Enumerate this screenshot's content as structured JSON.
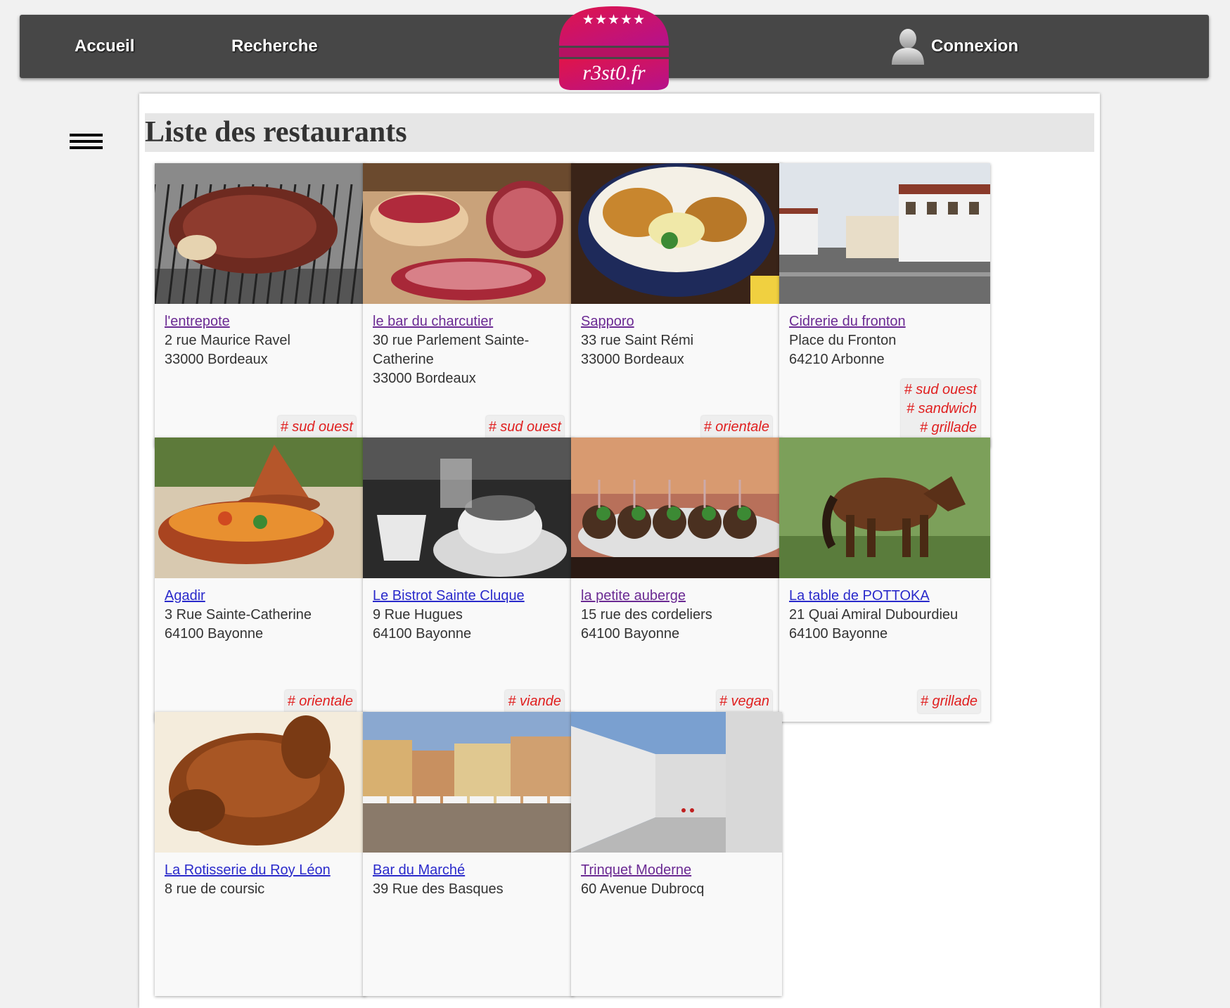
{
  "nav": {
    "accueil": "Accueil",
    "recherche": "Recherche",
    "connexion": "Connexion"
  },
  "logo": {
    "text": "r3st0.fr",
    "stars": "★★★★★",
    "color_top": "#e0144a",
    "color_bottom": "#b5128c"
  },
  "page": {
    "title": "Liste des restaurants"
  },
  "restaurants": [
    {
      "name": "l'entrepote",
      "address": "2 rue Maurice Ravel",
      "city": "33000 Bordeaux",
      "tags": [
        "# sud ouest"
      ],
      "visited": true,
      "image": "grilled-steak"
    },
    {
      "name": "le bar du charcutier",
      "address": "30 rue Parlement Sainte-Catherine",
      "city": "33000 Bordeaux",
      "tags": [
        "# sud ouest"
      ],
      "visited": true,
      "image": "charcuterie"
    },
    {
      "name": "Sapporo",
      "address": "33 rue Saint Rémi",
      "city": "33000 Bordeaux",
      "tags": [
        "# orientale"
      ],
      "visited": true,
      "image": "donburi-bowl"
    },
    {
      "name": "Cidrerie du fronton",
      "address": "Place du Fronton",
      "city": "64210 Arbonne",
      "tags": [
        "# sud ouest",
        "# sandwich",
        "# grillade"
      ],
      "visited": true,
      "image": "basque-fronton"
    },
    {
      "name": "Agadir",
      "address": "3 Rue Sainte-Catherine",
      "city": "64100 Bayonne",
      "tags": [
        "# orientale"
      ],
      "visited": false,
      "image": "tajine"
    },
    {
      "name": "Le Bistrot Sainte Cluque",
      "address": "9 Rue Hugues",
      "city": "64100 Bayonne",
      "tags": [
        "# viande"
      ],
      "visited": false,
      "image": "coffee-cups"
    },
    {
      "name": "la petite auberge",
      "address": "15 rue des cordeliers",
      "city": "64100 Bayonne",
      "tags": [
        "# vegan"
      ],
      "visited": true,
      "image": "skewers-plate"
    },
    {
      "name": "La table de POTTOKA",
      "address": "21 Quai Amiral Dubourdieu",
      "city": "64100 Bayonne",
      "tags": [
        "# grillade"
      ],
      "visited": false,
      "image": "pottok-pony"
    },
    {
      "name": "La Rotisserie du Roy Léon",
      "address": "8 rue de coursic",
      "city": "",
      "tags": [],
      "visited": false,
      "image": "roast-chicken"
    },
    {
      "name": "Bar du Marché",
      "address": "39 Rue des Basques",
      "city": "",
      "tags": [],
      "visited": false,
      "image": "market-square"
    },
    {
      "name": "Trinquet Moderne",
      "address": "60 Avenue Dubrocq",
      "city": "",
      "tags": [],
      "visited": true,
      "image": "trinquet-court"
    }
  ]
}
